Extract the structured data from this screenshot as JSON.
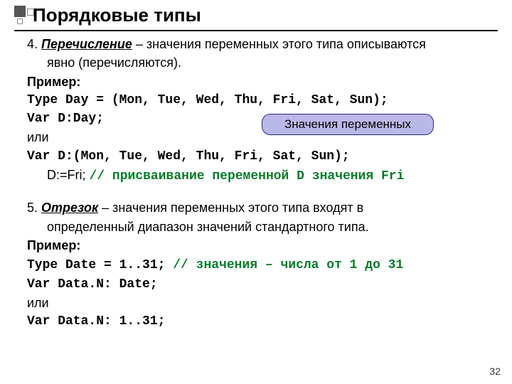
{
  "decor": {},
  "title": "Порядковые типы",
  "section4": {
    "num": "4. ",
    "term": "Перечисление",
    "dash": " – ",
    "desc1": "значения переменных этого типа описываются",
    "desc2": "явно (перечисляются).",
    "example_label": "Пример:",
    "code1": "Type Day = (Mon, Tue, Wed, Thu, Fri, Sat, Sun);",
    "code2": "Var D:Day;",
    "or": "или",
    "code3": "Var D:(Mon, Tue, Wed, Thu, Fri, Sat, Sun);",
    "assign_prefix": "D:=Fri; ",
    "assign_comment": "// присваивание переменной D значения Fri"
  },
  "callout": "Значения переменных",
  "section5": {
    "num": "5. ",
    "term": "Отрезок",
    "dash": " – ",
    "desc1": "значения переменных этого типа входят в",
    "desc2": "определенный диапазон значений стандартного типа.",
    "example_label": "Пример:",
    "code1a": "Type Date = 1..31; ",
    "code1b": "// значения – числа от 1 до 31",
    "code2": "Var Data.N: Date;",
    "or": "или",
    "code3": "Var Data.N: 1..31;"
  },
  "page_number": "32"
}
